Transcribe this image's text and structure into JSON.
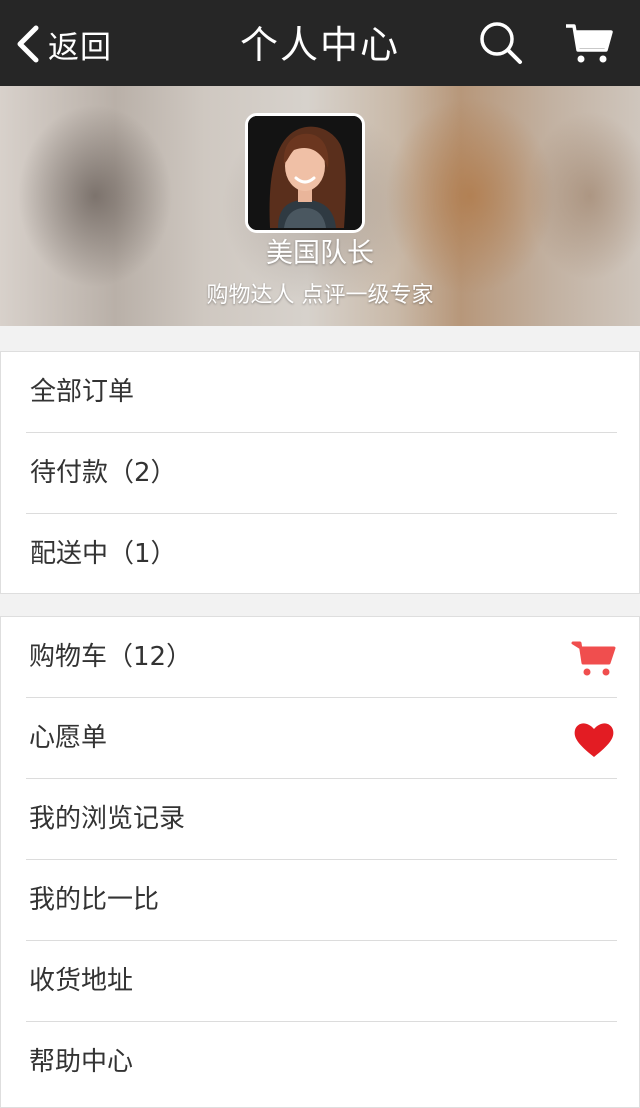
{
  "header": {
    "back_label": "返回",
    "title": "个人中心",
    "search_icon": "search-icon",
    "cart_icon": "shopping-cart-icon"
  },
  "profile": {
    "name": "美国队长",
    "subtitle": "购物达人  点评一级专家"
  },
  "orders": {
    "items": [
      {
        "label": "全部订单"
      },
      {
        "label": "待付款（2）"
      },
      {
        "label": "配送中（1）"
      }
    ]
  },
  "menu": {
    "items": [
      {
        "label": "购物车（12）",
        "icon": "shopping-cart-icon"
      },
      {
        "label": "心愿单",
        "icon": "heart-icon"
      },
      {
        "label": "我的浏览记录"
      },
      {
        "label": "我的比一比"
      },
      {
        "label": "收货地址"
      },
      {
        "label": "帮助中心"
      }
    ]
  },
  "colors": {
    "header_bg": "#262626",
    "accent_cart": "#f04e4e",
    "accent_heart": "#e31c23"
  }
}
